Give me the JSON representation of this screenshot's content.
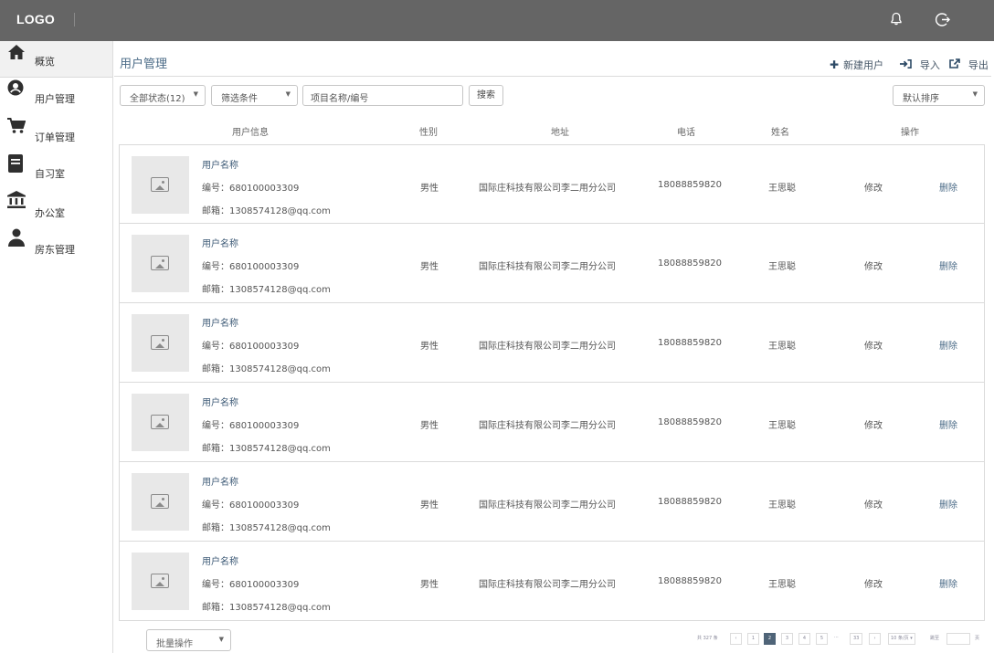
{
  "header": {
    "logo": "LOGO"
  },
  "sidebar": {
    "items": [
      {
        "label": "概览",
        "icon": "home-icon"
      },
      {
        "label": "用户管理",
        "icon": "user-circle-icon"
      },
      {
        "label": "订单管理",
        "icon": "cart-icon"
      },
      {
        "label": "自习室",
        "icon": "book-icon"
      },
      {
        "label": "办公室",
        "icon": "bank-icon"
      },
      {
        "label": "房东管理",
        "icon": "person-icon"
      }
    ]
  },
  "main": {
    "title": "用户管理",
    "actions": {
      "new_user": "新建用户",
      "import": "导入",
      "export": "导出"
    },
    "filters": {
      "status": "全部状态(12)",
      "condition": "筛选条件",
      "search_placeholder": "项目名称/编号",
      "search_button": "搜索",
      "sort": "默认排序"
    },
    "table": {
      "columns": [
        "用户信息",
        "性别",
        "地址",
        "电话",
        "姓名",
        "操作"
      ],
      "rows": [
        {
          "name": "用户名称",
          "id": "编号：680100003309",
          "email": "邮箱：1308574128@qq.com",
          "gender": "男性",
          "address": "国际庄科技有限公司李二用分公司",
          "phone": "18088859820",
          "realname": "王思聪",
          "edit": "修改",
          "delete": "删除"
        },
        {
          "name": "用户名称",
          "id": "编号：680100003309",
          "email": "邮箱：1308574128@qq.com",
          "gender": "男性",
          "address": "国际庄科技有限公司李二用分公司",
          "phone": "18088859820",
          "realname": "王思聪",
          "edit": "修改",
          "delete": "删除"
        },
        {
          "name": "用户名称",
          "id": "编号：680100003309",
          "email": "邮箱：1308574128@qq.com",
          "gender": "男性",
          "address": "国际庄科技有限公司李二用分公司",
          "phone": "18088859820",
          "realname": "王思聪",
          "edit": "修改",
          "delete": "删除"
        },
        {
          "name": "用户名称",
          "id": "编号：680100003309",
          "email": "邮箱：1308574128@qq.com",
          "gender": "男性",
          "address": "国际庄科技有限公司李二用分公司",
          "phone": "18088859820",
          "realname": "王思聪",
          "edit": "修改",
          "delete": "删除"
        },
        {
          "name": "用户名称",
          "id": "编号：680100003309",
          "email": "邮箱：1308574128@qq.com",
          "gender": "男性",
          "address": "国际庄科技有限公司李二用分公司",
          "phone": "18088859820",
          "realname": "王思聪",
          "edit": "修改",
          "delete": "删除"
        },
        {
          "name": "用户名称",
          "id": "编号：680100003309",
          "email": "邮箱：1308574128@qq.com",
          "gender": "男性",
          "address": "国际庄科技有限公司李二用分公司",
          "phone": "18088859820",
          "realname": "王思聪",
          "edit": "修改",
          "delete": "删除"
        }
      ]
    },
    "footer": {
      "batch": "批量操作",
      "total": "共 327 条",
      "prev": "‹",
      "next": "›",
      "pages": [
        "1",
        "2",
        "3",
        "4",
        "5",
        "···",
        "33"
      ],
      "per_page": "10 条/页 ▾",
      "goto": "跳至",
      "page_unit": "页"
    }
  },
  "colors": {
    "topbar": "#656565",
    "accent": "#4a6a86",
    "active_page": "#4f6478"
  }
}
